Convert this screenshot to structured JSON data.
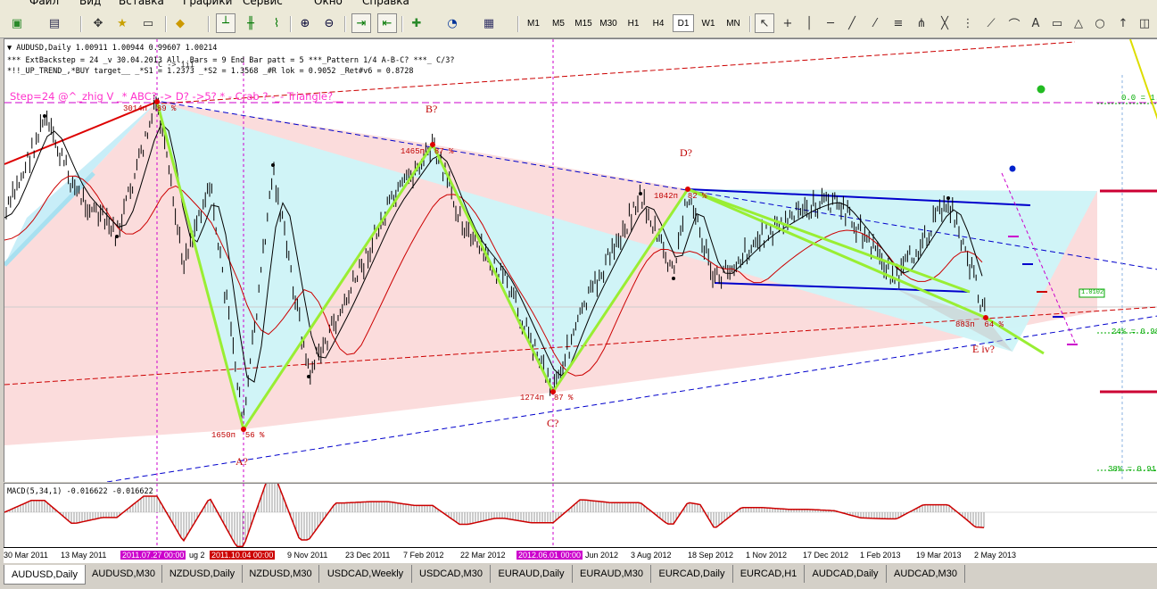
{
  "menu": [
    "Файл",
    "Вид",
    "Вставка",
    "Графики",
    "Сервис",
    "Окно",
    "Справка"
  ],
  "timeframes": [
    "M1",
    "M5",
    "M15",
    "M30",
    "H1",
    "H4",
    "D1",
    "W1",
    "MN"
  ],
  "active_timeframe": "D1",
  "chart": {
    "symbol_line": "AUDUSD,Daily  1.00911 1.00944 0.99607 1.00214",
    "info_line1": "***  ExtBackstep =  24   _v 30.04.2013   All. Bars = 9    End Bar patt = 5    ***_Pattern 1/4  A-B-C?  ***_  C/3?",
    "info_line2": "*!!_UP_TREND_,*BUY target__   _*S1 = 1.2373   _*S2 = 1.3568   _#R lok =  0.9052   _Ret#v6 = 0.8728",
    "step_line": "Step=24 @^_zhig V _* ABC? -> D? ->5? * - Crab ? -_- Triangle?__",
    "overlap_text": "C -> iii",
    "wave_labels": [
      "A?",
      "B?",
      "C?",
      "D?",
      "E  iv?"
    ],
    "pivot_labels": [
      {
        "text": "3014п",
        "pct": "89 %"
      },
      {
        "text": "1465п",
        "pct": "87 %"
      },
      {
        "text": "1042п",
        "pct": "82 %"
      },
      {
        "text": "1650п",
        "pct": "56 %"
      },
      {
        "text": "1274п",
        "pct": "87 %"
      },
      {
        "text": "883п",
        "pct": "64 %"
      }
    ],
    "fib_labels": [
      "0.0 = 1.1",
      "24% = 0.98",
      "38% = 0.91"
    ],
    "price_marker": "1.0102"
  },
  "macd": {
    "label": "MACD(5,34,1) -0.016622 -0.016622"
  },
  "time_axis": [
    "30 Mar 2011",
    "13 May 2011",
    "2011.07.27 00:00",
    "ug 2",
    "2011.10.04 00:00",
    "9 Nov 2011",
    "23 Dec 2011",
    "7 Feb 2012",
    "22 Mar 2012",
    "2012.06.01 00:00",
    "Jun 2012",
    "3 Aug 2012",
    "18 Sep 2012",
    "1 Nov 2012",
    "17 Dec 2012",
    "1 Feb 2013",
    "19 Mar 2013",
    "2 May 2013"
  ],
  "tabs": [
    "AUDUSD,Daily",
    "AUDUSD,M30",
    "NZDUSD,Daily",
    "NZDUSD,M30",
    "USDCAD,Weekly",
    "USDCAD,M30",
    "EURAUD,Daily",
    "EURAUD,M30",
    "EURCAD,Daily",
    "EURCAD,H1",
    "AUDCAD,Daily",
    "AUDCAD,M30"
  ],
  "active_tab": "AUDUSD,Daily",
  "colors": {
    "zigzag": "#99ee33",
    "trend_blue": "#0000cc",
    "ma_red": "#cc0000",
    "highlight_magenta": "#cc00cc",
    "triangle_fill": "#c8f4f8",
    "pink_fill": "#fbdcdc"
  }
}
